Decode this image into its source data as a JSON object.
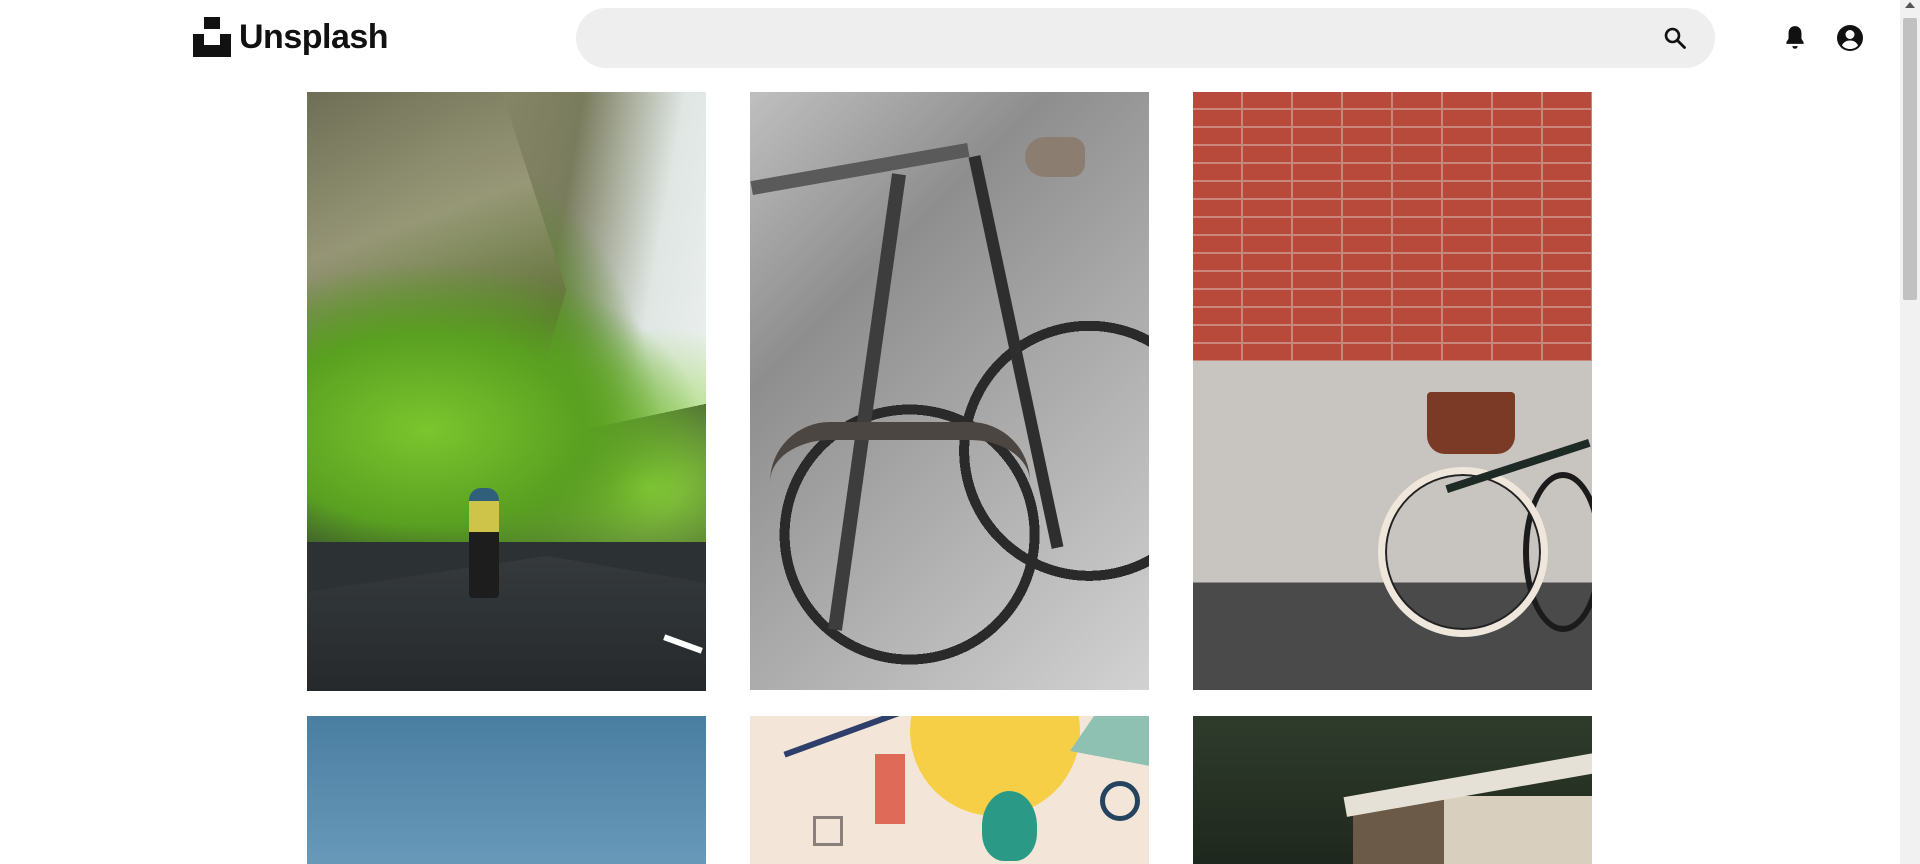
{
  "header": {
    "logo_text": "Unsplash",
    "search": {
      "value": "",
      "placeholder": ""
    },
    "icons": {
      "search": "search-icon",
      "notifications": "bell-icon",
      "account": "user-icon"
    }
  },
  "photos": [
    {
      "id": "cyclist-gorge",
      "subject": "photo"
    },
    {
      "id": "bicycles-closeup",
      "subject": "photo"
    },
    {
      "id": "bike-brick-wall",
      "subject": "photo"
    },
    {
      "id": "blue-sky",
      "subject": "photo"
    },
    {
      "id": "abstract-shapes",
      "subject": "photo"
    },
    {
      "id": "wooden-cabin",
      "subject": "photo"
    }
  ],
  "colors": {
    "search_bg": "#eeeeee",
    "text": "#111111",
    "scroll_thumb": "#c1c1c1"
  }
}
